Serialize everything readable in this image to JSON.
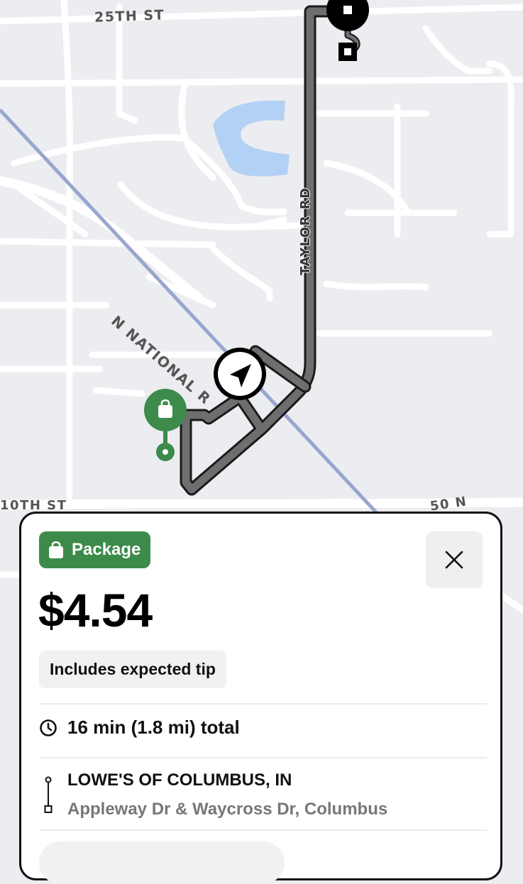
{
  "map": {
    "street_labels": {
      "st_25th": "25TH ST",
      "st_10th": "10TH ST",
      "rd_50n": "50 N",
      "n_national": "N NATIONAL R",
      "taylor_rd": "TAYLOR RD"
    },
    "icons": {
      "pickup_marker": "shopping-bag-pin-icon",
      "driver_position": "navigation-arrow-icon",
      "dropoff_marker": "destination-pin-icon"
    },
    "colors": {
      "route": "#6e6e6e",
      "water": "#b3d1f5",
      "rail": "#98a6cf",
      "pickup": "#3d8b4b"
    }
  },
  "offer_card": {
    "badge": {
      "label": "Package",
      "icon": "shopping-bag-icon",
      "color": "#3d8b4b"
    },
    "close_icon": "close-icon",
    "price": "$4.54",
    "tip_note": "Includes expected tip",
    "trip": {
      "icon": "clock-icon",
      "summary": "16 min (1.8 mi) total"
    },
    "pickup": {
      "icon": "route-pin-icon",
      "name": "LOWE'S OF COLUMBUS, IN",
      "address": "Appleway Dr & Waycross Dr, Columbus"
    }
  }
}
